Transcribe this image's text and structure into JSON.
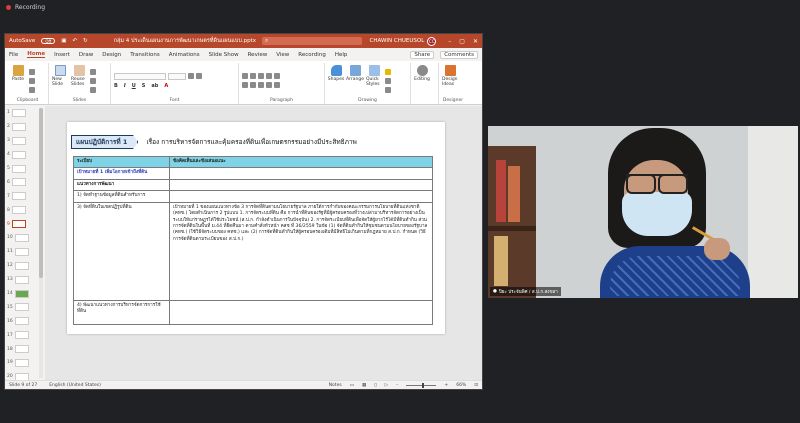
{
  "recording": {
    "label": "Recording"
  },
  "titlebar": {
    "autosave": "AutoSave",
    "autosave_state": "Off",
    "filename": "กลุ่ม 4 ประเด็นแผนงานการพัฒนาเกษตรที่ดินแผนแบบ.pptx",
    "user_name": "CHAWIN CHUEUSOL",
    "user_initials": "CC"
  },
  "tabs": [
    "File",
    "Home",
    "Insert",
    "Draw",
    "Design",
    "Transitions",
    "Animations",
    "Slide Show",
    "Review",
    "View",
    "Recording",
    "Help"
  ],
  "active_tab": "Home",
  "share": {
    "share": "Share",
    "comments": "Comments"
  },
  "ribbon": {
    "clipboard": "Clipboard",
    "paste": "Paste",
    "slides": "Slides",
    "new_slide": "New Slide",
    "reuse_slides": "Reuse Slides",
    "font": "Font",
    "paragraph": "Paragraph",
    "drawing": "Drawing",
    "shapes": "Shapes",
    "arrange": "Arrange",
    "quick_styles": "Quick Styles",
    "editing": "Editing",
    "designer": "Designer",
    "design_ideas": "Design Ideas"
  },
  "thumbnails": [
    "1",
    "2",
    "3",
    "4",
    "5",
    "6",
    "7",
    "8",
    "9",
    "10",
    "11",
    "12",
    "13",
    "14",
    "15",
    "16",
    "17",
    "18",
    "19",
    "20"
  ],
  "active_slide": "9",
  "slide": {
    "plan_tag": "แผนปฏิบัติการที่ 1",
    "subject": "เรื่อง การบริหารจัดการและคุ้มครองที่ดินเพื่อเกษตรกรรมอย่างมีประสิทธิภาพ",
    "headers": [
      "ระเบียบ",
      "ข้อคิดเห็นและข้อเสนอแนะ"
    ],
    "goal": "เป้าหมายที่ 1 เพิ่มโอกาสเข้าถึงที่ดิน",
    "approach": "แนวทางการพัฒนา",
    "row1": "1) จัดทำฐานข้อมูลที่ดินสำหรับการ",
    "row3_left": "3) จัดที่ดินในเขตปฏิรูปที่ดิน",
    "row3_right": "เป้าหมายที่ 1 ของแผนแนวทางข้อ 3 การจัดที่ดินตามนโยบายรัฐบาล ภายใต้การกำกับของคณะกรรมการนโยบายที่ดินแห่งชาติ (คทช.) โดยดำเนินการ 2 รูปแบบ 1. การจัดระบบที่ดิน คือ การนำที่ดินของรัฐที่มีผู้ครอบครองที่ว่างเปล่ามาบริหารจัดการอย่างเป็นระบบให้แก่ราษฎรได้ใช้ประโยชน์ (ส.ป.ก. กำลังดำเนินการในปัจจุบัน) 2. การจัดระเบียบที่ดินเพื่อจัดให้ผู้ยากไร้ได้มีที่ดินทำกิน ส่วนการจัดที่ดินในพื้นที่ ม.44 ที่ยึดคืนมา ตามคำสั่งหัวหน้า คสช ที่ 36/2559 ในข้อ (1) จัดที่ดินทำกินให้ชุมชนตามนโยบายของรัฐบาล (คทช.) (ใช้วิธีจัดระบบของ คทช.) และ (2) การจัดที่ดินทำกินให้ผู้ครอบครองเดิมที่มีสิทธิไม่เกินตามที่กฎหมาย ส.ป.ก. กำหนด (วิธีการจัดที่ดินตามระเบียบของ ส.ป.ก.)",
    "row4": "4) พัฒนาแนวทางการบริหารจัดการการใช้ที่ดิน"
  },
  "status": {
    "slide_of": "Slide 9 of 27",
    "language": "English (United States)",
    "notes": "Notes",
    "zoom": "66%"
  },
  "video": {
    "name": "ปิยะ ประจันพิศ / ส.ป.ก.สงขลา"
  }
}
